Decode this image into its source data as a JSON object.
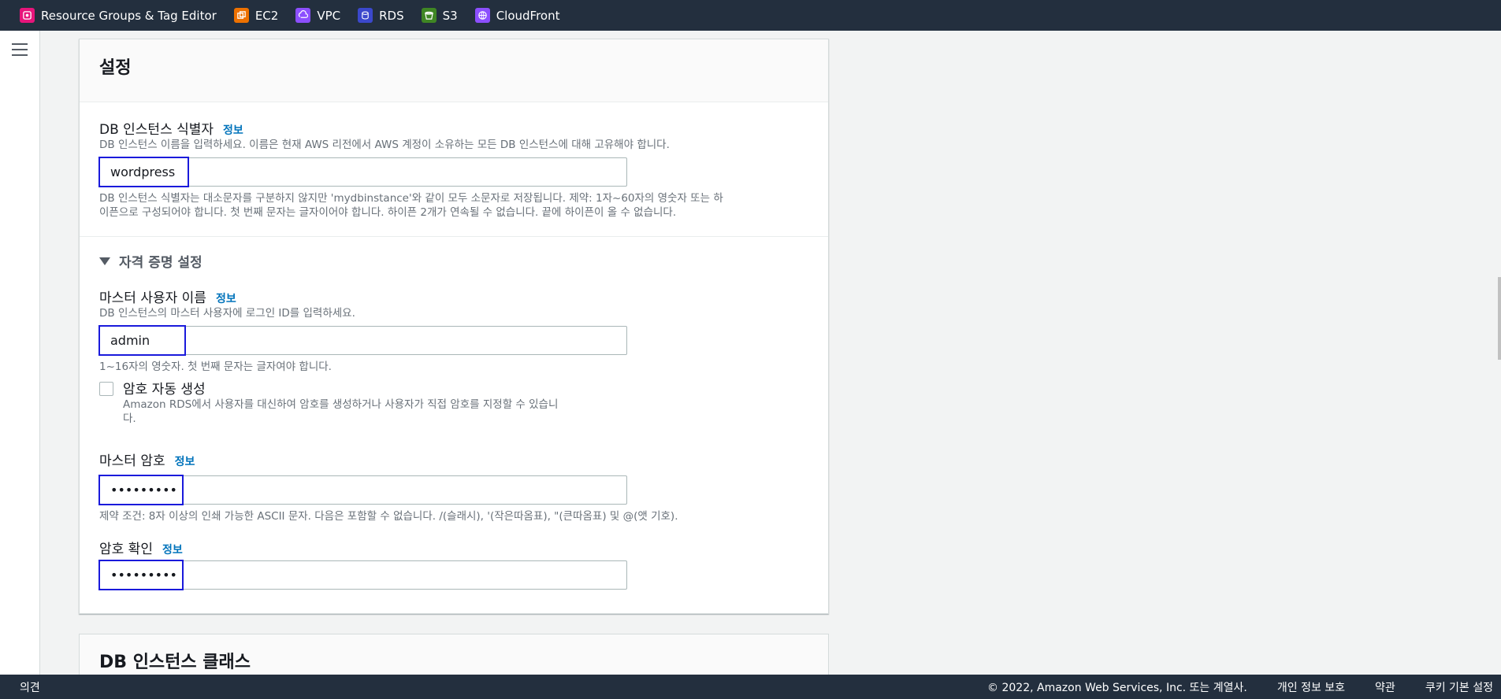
{
  "favorites": [
    {
      "label": "Resource Groups & Tag Editor",
      "icon": "resource-groups-icon",
      "color": "#e7157b"
    },
    {
      "label": "EC2",
      "icon": "ec2-icon",
      "color": "#ed7100"
    },
    {
      "label": "VPC",
      "icon": "vpc-icon",
      "color": "#8c4fff"
    },
    {
      "label": "RDS",
      "icon": "rds-icon",
      "color": "#3b48cc"
    },
    {
      "label": "S3",
      "icon": "s3-icon",
      "color": "#3f8624"
    },
    {
      "label": "CloudFront",
      "icon": "cloudfront-icon",
      "color": "#8c4fff"
    }
  ],
  "settings": {
    "title": "설정",
    "instance_id": {
      "label": "DB 인스턴스 식별자",
      "info": "정보",
      "description": "DB 인스턴스 이름을 입력하세요. 이름은 현재 AWS 리전에서 AWS 계정이 소유하는 모든 DB 인스턴스에 대해 고유해야 합니다.",
      "value": "wordpress",
      "constraint_line1": "DB 인스턴스 식별자는 대소문자를 구분하지 않지만 'mydbinstance'와 같이 모두 소문자로 저장됩니다. 제약: 1자~60자의 영숫자 또는 하",
      "constraint_line2": "이픈으로 구성되어야 합니다. 첫 번째 문자는 글자이어야 합니다. 하이픈 2개가 연속될 수 없습니다. 끝에 하이픈이 올 수 없습니다."
    },
    "credentials": {
      "title": "자격 증명 설정",
      "master_username": {
        "label": "마스터 사용자 이름",
        "info": "정보",
        "description": "DB 인스턴스의 마스터 사용자에 로그인 ID를 입력하세요.",
        "value": "admin",
        "constraint": "1~16자의 영숫자. 첫 번째 문자는 글자여야 합니다."
      },
      "auto_generate": {
        "label": "암호 자동 생성",
        "checked": false,
        "description_line1": "Amazon RDS에서 사용자를 대신하여 암호를 생성하거나 사용자가 직접 암호를 지정할 수 있습니",
        "description_line2": "다."
      },
      "master_password": {
        "label": "마스터 암호",
        "info": "정보",
        "value": "•••••••••",
        "constraint": "제약 조건: 8자 이상의 인쇄 가능한 ASCII 문자. 다음은 포함할 수 없습니다. /(슬래시), '(작은따옴표), \"(큰따옴표) 및 @(앳 기호)."
      },
      "confirm_password": {
        "label": "암호 확인",
        "info": "정보",
        "value": "•••••••••"
      }
    }
  },
  "instance_class": {
    "title": "DB 인스턴스 클래스"
  },
  "footer": {
    "feedback": "의견",
    "copyright": "© 2022, Amazon Web Services, Inc. 또는 계열사.",
    "privacy": "개인 정보 보호",
    "terms": "약관",
    "cookies": "쿠키 기본 설정"
  }
}
